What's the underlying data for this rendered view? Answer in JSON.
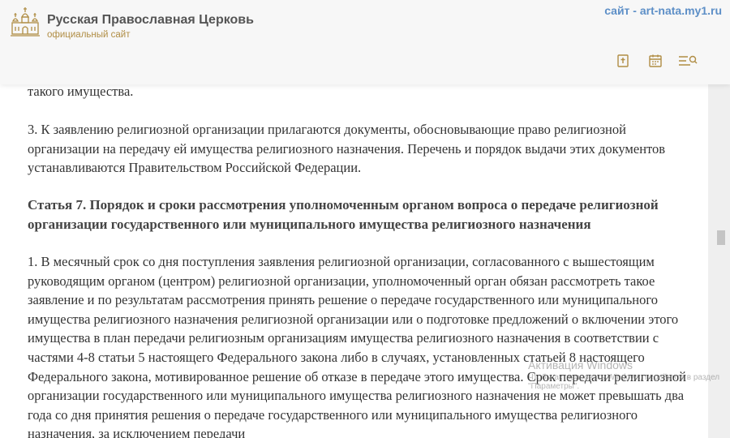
{
  "header": {
    "site_title": "Русская Православная Церковь",
    "site_subtitle": "официальный сайт",
    "watermark_link": "сайт - art-nata.my1.ru",
    "logo_icon": "church-domes-icon",
    "toolbar": [
      {
        "name": "bible-icon"
      },
      {
        "name": "calendar-icon"
      },
      {
        "name": "search-menu-icon"
      }
    ]
  },
  "article": {
    "tail_text": "такого имущества.",
    "p3": "3. К заявлению религиозной организации прилагаются документы, обосновывающие право религиозной организации на передачу ей имущества религиозного назначения. Перечень и порядок выдачи этих документов устанавливаются Правительством Российской Федерации.",
    "article7_heading": "Статья 7. Порядок и сроки рассмотрения уполномоченным органом вопроса о передаче религиозной организации государственного или муниципального имущества религиозного назначения",
    "article7_p1": "1. В месячный срок со дня поступления заявления религиозной организации, согласованного с вышестоящим руководящим органом (центром) религиозной организации, уполномоченный орган обязан рассмотреть такое заявление и по результатам рассмотрения принять решение о передаче государственного или муниципального имущества религиозного назначения религиозной организации или о подготовке предложений о включении этого имущества в план передачи религиозным организациям имущества религиозного назначения в соответствии с частями 4-8 статьи 5 настоящего Федерального закона либо в случаях, установленных статьей 8 настоящего Федерального закона, мотивированное решение об отказе в передаче этого имущества. Срок передачи религиозной организации государственного или муниципального имущества религиозного назначения не может превышать два года со дня принятия решения о передаче государственного или муниципального имущества религиозного назначения, за исключением передачи"
  },
  "windows_activation": {
    "title": "Активация Windows",
    "subtitle": "Чтобы активировать Windows, перейдите в раздел \"Параметры\"."
  },
  "colors": {
    "accent": "#b08d44",
    "link": "#5d8fc7",
    "text": "#333333"
  }
}
